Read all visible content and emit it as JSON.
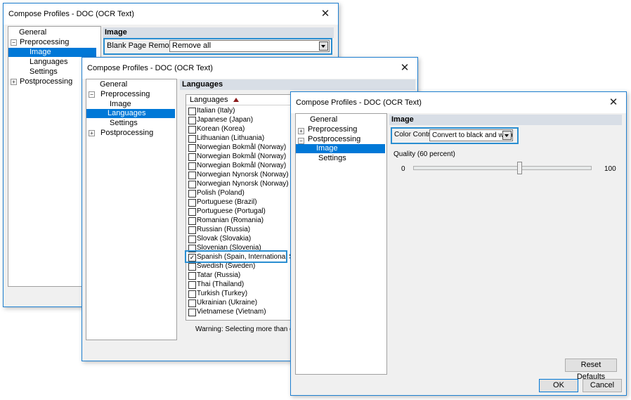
{
  "window1": {
    "title": "Compose Profiles  -  DOC (OCR Text)",
    "tree": [
      "General",
      "Preprocessing",
      "Image",
      "Languages",
      "Settings",
      "Postprocessing"
    ],
    "expanders": [
      "−",
      "+"
    ],
    "section": "Image",
    "blank_page_label": "Blank Page Removal:",
    "blank_page_value": "Remove all"
  },
  "window2": {
    "title": "Compose Profiles  -  DOC (OCR Text)",
    "tree": [
      "General",
      "Preprocessing",
      "Image",
      "Languages",
      "Settings",
      "Postprocessing"
    ],
    "expanders": [
      "−",
      "+"
    ],
    "section": "Languages",
    "list_header": "Languages",
    "languages": [
      "Italian (Italy)",
      "Japanese (Japan)",
      "Korean (Korea)",
      "Lithuanian (Lithuania)",
      "Norwegian Bokmål (Norway)",
      "Norwegian Bokmål (Norway)",
      "Norwegian Bokmål (Norway)",
      "Norwegian Nynorsk (Norway)",
      "Norwegian Nynorsk (Norway)",
      "Polish (Poland)",
      "Portuguese (Brazil)",
      "Portuguese (Portugal)",
      "Romanian (Romania)",
      "Russian (Russia)",
      "Slovak (Slovakia)",
      "Slovenian (Slovenia)",
      "Spanish (Spain, International Sort)",
      "Swedish (Sweden)",
      "Tatar (Russia)",
      "Thai (Thailand)",
      "Turkish (Turkey)",
      "Ukrainian (Ukraine)",
      "Vietnamese (Vietnam)"
    ],
    "checked_index": 16,
    "check_mark": "✓",
    "warning": "Warning: Selecting more than one lan"
  },
  "window3": {
    "title": "Compose Profiles  -  DOC (OCR Text)",
    "tree": [
      "General",
      "Preprocessing",
      "Postprocessing",
      "Image",
      "Settings"
    ],
    "expanders": [
      "+",
      "−"
    ],
    "section": "Image",
    "color_control_label": "Color Control:",
    "color_control_value": "Convert to black and white",
    "quality_label": "Quality (60 percent)",
    "quality_value": 60,
    "slider_min": "0",
    "slider_max": "100",
    "reset_label": "Reset Defaults",
    "ok_label": "OK",
    "cancel_label": "Cancel"
  },
  "close_glyph": "✕"
}
